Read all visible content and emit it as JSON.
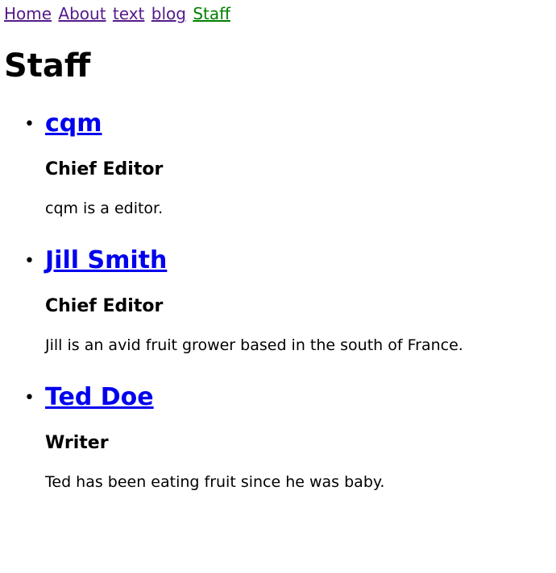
{
  "nav": {
    "items": [
      {
        "label": "Home"
      },
      {
        "label": "About"
      },
      {
        "label": "text"
      },
      {
        "label": "blog"
      },
      {
        "label": "Staff"
      }
    ],
    "active": "Staff",
    "colors": {
      "visited": "#551a8b",
      "active": "#008000"
    }
  },
  "page": {
    "title": "Staff"
  },
  "staff": [
    {
      "name": "cqm",
      "role": "Chief Editor",
      "bio": "cqm is a editor."
    },
    {
      "name": "Jill Smith",
      "role": "Chief Editor",
      "bio": "Jill is an avid fruit grower based in the south of France."
    },
    {
      "name": "Ted Doe",
      "role": "Writer",
      "bio": "Ted has been eating fruit since he was baby."
    }
  ],
  "link_color": "#0000ee"
}
